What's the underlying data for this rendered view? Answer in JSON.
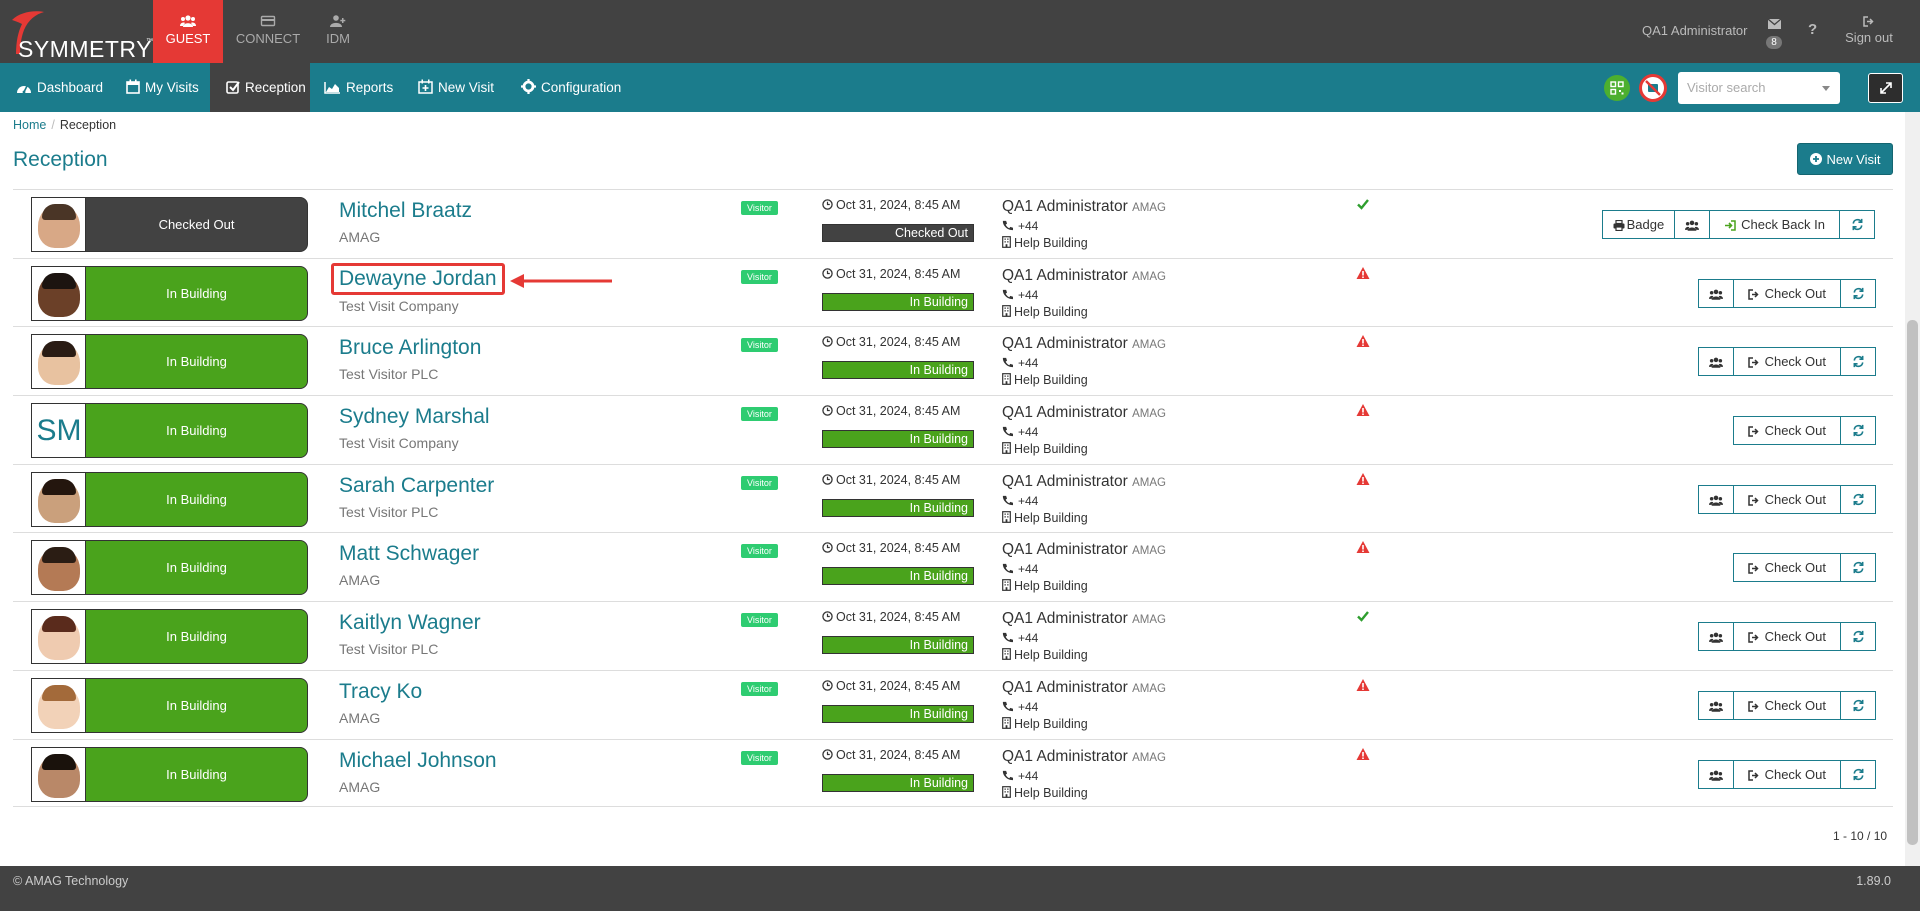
{
  "app": {
    "logo_text": "SYMMETRY",
    "logo_tm": "™"
  },
  "modules": [
    {
      "label": "GUEST",
      "active": true
    },
    {
      "label": "CONNECT",
      "active": false
    },
    {
      "label": "IDM",
      "active": false
    }
  ],
  "topbar": {
    "user": "QA1 Administrator",
    "mail_count": "8",
    "help": "?",
    "signout": "Sign out"
  },
  "nav": {
    "dashboard": "Dashboard",
    "my_visits": "My Visits",
    "reception": "Reception",
    "reports": "Reports",
    "new_visit": "New Visit",
    "configuration": "Configuration"
  },
  "search": {
    "placeholder": "Visitor search"
  },
  "breadcrumb": {
    "home": "Home",
    "sep": "/",
    "current": "Reception"
  },
  "page": {
    "title": "Reception",
    "new_visit_button": "New Visit"
  },
  "colors": {
    "accent": "#1b7c8c",
    "in_building": "#4aa31c",
    "checked_out": "#424242",
    "guest_tab": "#e53935",
    "alert": "#e53935",
    "ok": "#2e9e2e"
  },
  "visits": [
    {
      "status": "Checked Out",
      "name": "Mitchel Braatz",
      "company": "AMAG",
      "tag": "Visitor",
      "time": "Oct 31, 2024, 8:45 AM",
      "host": "QA1 Administrator",
      "host_org": "AMAG",
      "phone": "+44",
      "location": "Help Building",
      "indicator": "check-icon",
      "actions": [
        "Badge",
        "group",
        "Check Back In",
        "refresh"
      ]
    },
    {
      "status": "In Building",
      "name": "Dewayne Jordan",
      "company": "Test Visit Company",
      "tag": "Visitor",
      "time": "Oct 31, 2024, 8:45 AM",
      "host": "QA1 Administrator",
      "host_org": "AMAG",
      "phone": "+44",
      "location": "Help Building",
      "indicator": "warning-icon",
      "actions": [
        "group",
        "Check Out",
        "refresh"
      ]
    },
    {
      "status": "In Building",
      "name": "Bruce Arlington",
      "company": "Test Visitor PLC",
      "tag": "Visitor",
      "time": "Oct 31, 2024, 8:45 AM",
      "host": "QA1 Administrator",
      "host_org": "AMAG",
      "phone": "+44",
      "location": "Help Building",
      "indicator": "warning-icon",
      "actions": [
        "group",
        "Check Out",
        "refresh"
      ]
    },
    {
      "status": "In Building",
      "name": "Sydney Marshal",
      "company": "Test Visit Company",
      "tag": "Visitor",
      "time": "Oct 31, 2024, 8:45 AM",
      "host": "QA1 Administrator",
      "host_org": "AMAG",
      "phone": "+44",
      "location": "Help Building",
      "indicator": "warning-icon",
      "initials": "SM",
      "actions": [
        "Check Out",
        "refresh"
      ]
    },
    {
      "status": "In Building",
      "name": "Sarah Carpenter",
      "company": "Test Visitor PLC",
      "tag": "Visitor",
      "time": "Oct 31, 2024, 8:45 AM",
      "host": "QA1 Administrator",
      "host_org": "AMAG",
      "phone": "+44",
      "location": "Help Building",
      "indicator": "warning-icon",
      "actions": [
        "group",
        "Check Out",
        "refresh"
      ]
    },
    {
      "status": "In Building",
      "name": "Matt Schwager",
      "company": "AMAG",
      "tag": "Visitor",
      "time": "Oct 31, 2024, 8:45 AM",
      "host": "QA1 Administrator",
      "host_org": "AMAG",
      "phone": "+44",
      "location": "Help Building",
      "indicator": "warning-icon",
      "actions": [
        "Check Out",
        "refresh"
      ]
    },
    {
      "status": "In Building",
      "name": "Kaitlyn Wagner",
      "company": "Test Visitor PLC",
      "tag": "Visitor",
      "time": "Oct 31, 2024, 8:45 AM",
      "host": "QA1 Administrator",
      "host_org": "AMAG",
      "phone": "+44",
      "location": "Help Building",
      "indicator": "check-icon",
      "actions": [
        "group",
        "Check Out",
        "refresh"
      ]
    },
    {
      "status": "In Building",
      "name": "Tracy Ko",
      "company": "AMAG",
      "tag": "Visitor",
      "time": "Oct 31, 2024, 8:45 AM",
      "host": "QA1 Administrator",
      "host_org": "AMAG",
      "phone": "+44",
      "location": "Help Building",
      "indicator": "warning-icon",
      "actions": [
        "group",
        "Check Out",
        "refresh"
      ]
    },
    {
      "status": "In Building",
      "name": "Michael Johnson",
      "company": "AMAG",
      "tag": "Visitor",
      "time": "Oct 31, 2024, 8:45 AM",
      "host": "QA1 Administrator",
      "host_org": "AMAG",
      "phone": "+44",
      "location": "Help Building",
      "indicator": "warning-icon",
      "actions": [
        "group",
        "Check Out",
        "refresh"
      ]
    }
  ],
  "pager": "1 - 10 / 10",
  "footer": {
    "copyright": "© AMAG Technology",
    "version": "1.89.0"
  }
}
